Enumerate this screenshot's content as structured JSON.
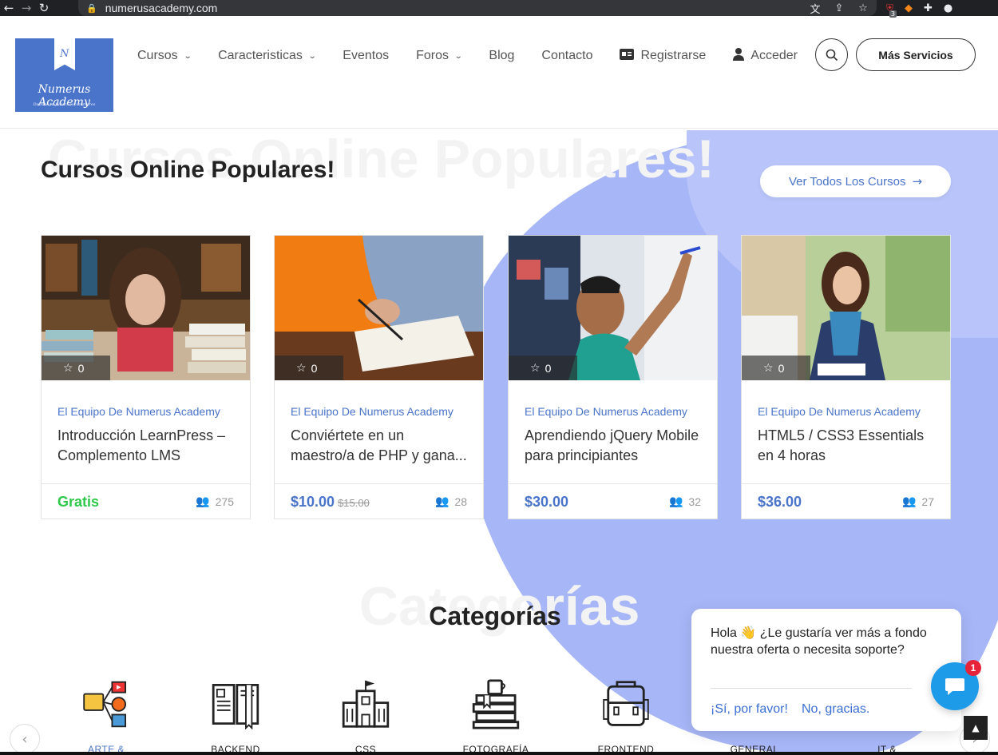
{
  "browser": {
    "url": "numerusacademy.com",
    "back_icon": "back-arrow-icon",
    "forward_icon": "forward-arrow-icon",
    "reload_icon": "reload-icon",
    "extension_badge": "3"
  },
  "header": {
    "logo": {
      "brand": "Numerus Academy",
      "tagline": "Domina tu futuro con numeros",
      "letter": "N"
    },
    "nav": [
      {
        "label": "Cursos",
        "dropdown": true
      },
      {
        "label": "Caracteristicas",
        "dropdown": true
      },
      {
        "label": "Eventos",
        "dropdown": false
      },
      {
        "label": "Foros",
        "dropdown": true
      },
      {
        "label": "Blog",
        "dropdown": false
      },
      {
        "label": "Contacto",
        "dropdown": false
      },
      {
        "label": "Registrarse",
        "dropdown": false
      },
      {
        "label": "Acceder",
        "dropdown": false
      }
    ],
    "more_services": "Más Servicios"
  },
  "courses_section": {
    "bg_title": "Cursos Online Populares!",
    "title": "Cursos Online Populares!",
    "view_all": "Ver Todos Los Cursos",
    "cards": [
      {
        "rating": "0",
        "author": "El Equipo De Numerus Academy",
        "title": "Introducción LearnPress – Complemento LMS",
        "price": "Gratis",
        "old_price": "",
        "students": "275"
      },
      {
        "rating": "0",
        "author": "El Equipo De Numerus Academy",
        "title": "Conviértete en un maestro/a de PHP y gana...",
        "price": "$10.00",
        "old_price": "$15.00",
        "students": "28"
      },
      {
        "rating": "0",
        "author": "El Equipo De Numerus Academy",
        "title": "Aprendiendo jQuery Mobile para principiantes",
        "price": "$30.00",
        "old_price": "",
        "students": "32"
      },
      {
        "rating": "0",
        "author": "El Equipo De Numerus Academy",
        "title": "HTML5 / CSS3 Essentials en 4 horas",
        "price": "$36.00",
        "old_price": "",
        "students": "27"
      }
    ]
  },
  "categories_section": {
    "bg_title": "Categorías",
    "title": "Categorías",
    "items": [
      {
        "label": "ARTE &",
        "icon": "art-media-icon"
      },
      {
        "label": "BACKEND",
        "icon": "open-book-icon"
      },
      {
        "label": "CSS",
        "icon": "school-building-icon"
      },
      {
        "label": "FOTOGRAFÍA",
        "icon": "books-stack-icon"
      },
      {
        "label": "FRONTEND",
        "icon": "backpack-icon"
      },
      {
        "label": "GENERAL",
        "icon": "general-icon"
      },
      {
        "label": "IT &",
        "icon": "it-icon"
      }
    ]
  },
  "chat": {
    "message_pre": "Hola",
    "emoji": "👋",
    "message_post": "¿Le gustaría ver más a fondo nuestra oferta o necesita soporte?",
    "yes": "¡Sí, por favor!",
    "no": "No, gracias.",
    "badge": "1"
  },
  "colors": {
    "accent": "#4a74c9",
    "free": "#2ec94a",
    "blob": "#a7b6f7",
    "chat": "#1e9be8"
  }
}
